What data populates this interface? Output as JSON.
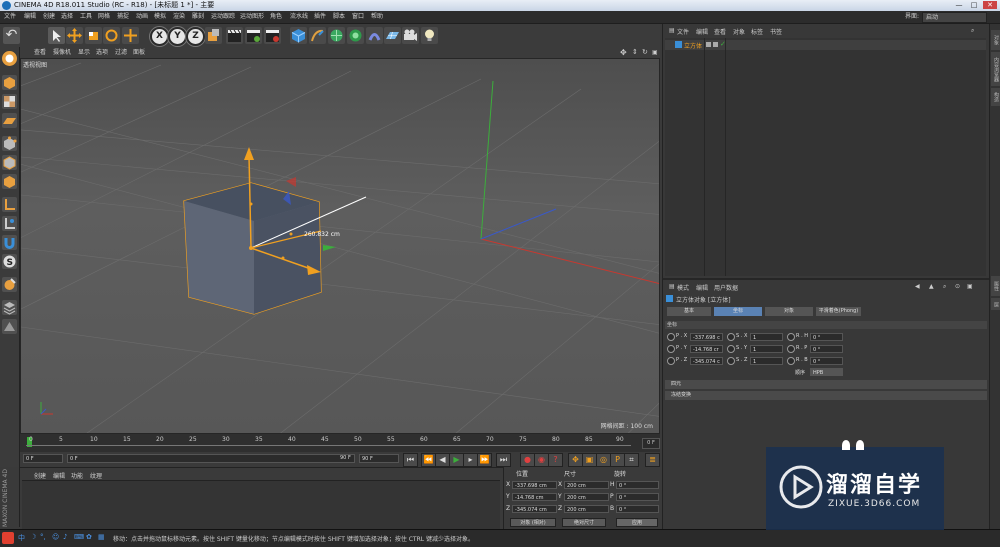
{
  "app": {
    "title": "CINEMA 4D R18.011 Studio (RC - R18) - [未标题 1 *] - 主要",
    "layout_label": "界面:",
    "layout_value": "启动",
    "minimize_label": "—",
    "maximize_label": "□",
    "close_label": "✕"
  },
  "menubar": [
    "文件",
    "编辑",
    "创建",
    "选择",
    "工具",
    "网格",
    "捕捉",
    "动画",
    "模拟",
    "渲染",
    "雕刻",
    "运动跟踪",
    "运动图形",
    "角色",
    "流水线",
    "插件",
    "脚本",
    "窗口",
    "帮助"
  ],
  "toolbar": {
    "undo_label": "↶",
    "axes": [
      "X",
      "Y",
      "Z"
    ]
  },
  "viewport": {
    "menu": [
      "查看",
      "摄像机",
      "显示",
      "选项",
      "过滤",
      "面板"
    ],
    "label": "透视视图",
    "grid_spacing": "网格间距 : 100 cm",
    "measure_label": "260.832 cm"
  },
  "timeline": {
    "ticks": [
      "0",
      "5",
      "10",
      "15",
      "20",
      "25",
      "30",
      "35",
      "40",
      "45",
      "50",
      "55",
      "60",
      "65",
      "70",
      "75",
      "80",
      "85",
      "90"
    ],
    "end_frame_box": "0 F",
    "current_frame": "0 F",
    "start_frame": "0 F",
    "preview_end": "90 F",
    "end_frame": "90 F"
  },
  "material_manager": {
    "menu": [
      "创建",
      "编辑",
      "功能",
      "纹理"
    ]
  },
  "coord_manager": {
    "headers": [
      "位置",
      "尺寸",
      "旋转"
    ],
    "rows": [
      {
        "axis": "X",
        "pos": "-337.698 cm",
        "size_axis": "X",
        "size": "200 cm",
        "rot_axis": "H",
        "rot": "0 °"
      },
      {
        "axis": "Y",
        "pos": "-14.768 cm",
        "size_axis": "Y",
        "size": "200 cm",
        "rot_axis": "P",
        "rot": "0 °"
      },
      {
        "axis": "Z",
        "pos": "-345.074 cm",
        "size_axis": "Z",
        "size": "200 cm",
        "rot_axis": "B",
        "rot": "0 °"
      }
    ],
    "mode_select": "对象 (相对)",
    "size_select": "绝对尺寸",
    "apply_button": "应用"
  },
  "object_manager": {
    "menu": [
      "文件",
      "编辑",
      "查看",
      "对象",
      "标签",
      "书签"
    ],
    "objects": [
      {
        "name": "立方体"
      }
    ]
  },
  "attribute_manager": {
    "menu": [
      "模式",
      "编辑",
      "用户数据"
    ],
    "object_title": "立方体对象 [立方体]",
    "tabs": [
      "基本",
      "坐标",
      "对象",
      "平滑着色(Phong)"
    ],
    "active_tab": "坐标",
    "section": "坐标",
    "pos_rows": [
      {
        "label": "P . X",
        "value": "-337.698 c"
      },
      {
        "label": "P . Y",
        "value": "-14.768 cr"
      },
      {
        "label": "P . Z",
        "value": "-345.074 c"
      }
    ],
    "scale_rows": [
      {
        "label": "S . X",
        "value": "1"
      },
      {
        "label": "S . Y",
        "value": "1"
      },
      {
        "label": "S . Z",
        "value": "1"
      }
    ],
    "rot_rows": [
      {
        "label": "R . H",
        "value": "0 °"
      },
      {
        "label": "R . P",
        "value": "0 °"
      },
      {
        "label": "R . B",
        "value": "0 °"
      }
    ],
    "order_label": "顺序",
    "order_value": "HPB",
    "sections": [
      "四元",
      "冻结变换"
    ]
  },
  "right_strip": [
    "对象",
    "内容浏览器",
    "构造",
    "属性",
    "层"
  ],
  "status_bar": {
    "message": "移动：点击并拖动鼠标移动元素。按住 SHIFT 键量化移动；节点编辑模式时按住 SHIFT 键增加选择对象；按住 CTRL 键减少选择对象。",
    "logo": "MAXON CINEMA 4D"
  },
  "watermark": {
    "title": "溜溜自学",
    "url": "ZIXUE.3D66.COM"
  },
  "colors": {
    "accent_orange": "#f0a020",
    "axis_x": "#c8382f",
    "axis_y": "#3cae3c",
    "axis_z": "#3a59c8",
    "active_tab": "#5a82b4"
  }
}
